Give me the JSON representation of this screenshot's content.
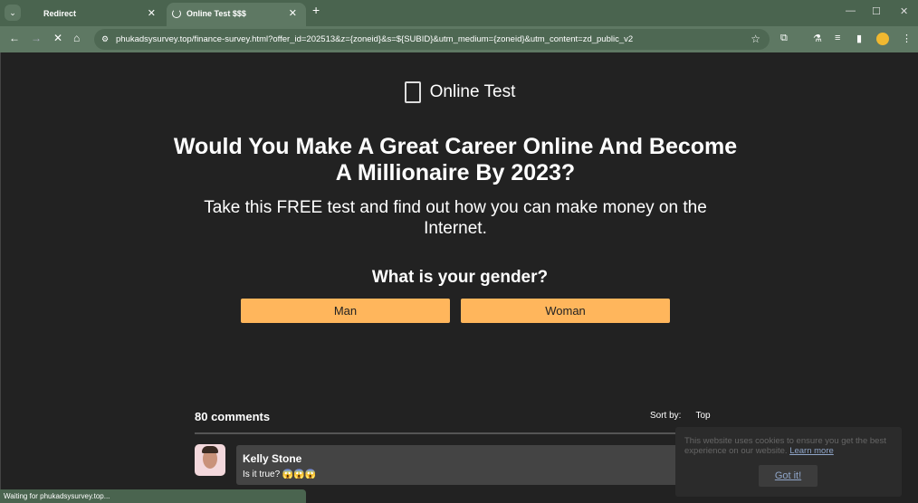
{
  "browser": {
    "tabs": [
      {
        "label": "Redirect"
      },
      {
        "label": "Online Test $$$",
        "loading": true
      }
    ],
    "url": "phukadsysurvey.top/finance-survey.html?offer_id=202513&z={zoneid}&s=${SUBID}&utm_medium={zoneid}&utm_content=zd_public_v2",
    "status": "Waiting for phukadsysurvey.top..."
  },
  "page": {
    "logo": "Online Test",
    "headline": "Would You Make A Great Career Online And Become A Millionaire By 2023?",
    "subtitle": "Take this FREE test and find out how you can make money on the Internet.",
    "question": "What is your gender?",
    "options": [
      "Man",
      "Woman"
    ],
    "accent": "#ffb65c"
  },
  "comments": {
    "count": "80 comments",
    "sort_label": "Sort by:",
    "sort_value": "Top",
    "items": [
      {
        "name": "Kelly Stone",
        "text": "Is it true? 😱😱😱"
      }
    ]
  },
  "cookie": {
    "text": "This website uses cookies to ensure you get the best experience on our website.",
    "link": "Learn more",
    "button": "Got it!"
  }
}
